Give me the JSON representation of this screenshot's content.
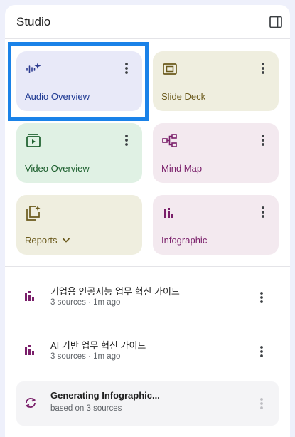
{
  "header": {
    "title": "Studio",
    "toggle_icon": "side-panel-icon"
  },
  "cards": [
    {
      "label": "Audio Overview",
      "icon": "audio-waveform-sparkle-icon",
      "color": "#1f3a93",
      "bg": "#e8e9f8"
    },
    {
      "label": "Slide Deck",
      "icon": "slides-icon",
      "color": "#6b5a1c",
      "bg": "#efeedf"
    },
    {
      "label": "Video Overview",
      "icon": "video-icon",
      "color": "#1b5e2c",
      "bg": "#e0f1e4"
    },
    {
      "label": "Mind Map",
      "icon": "mind-map-icon",
      "color": "#7a1f6a",
      "bg": "#f3e9ef"
    },
    {
      "label": "Reports",
      "icon": "reports-icon",
      "color": "#6b5a1c",
      "bg": "#efeedf"
    },
    {
      "label": "Infographic",
      "icon": "infographic-icon",
      "color": "#7a1f6a",
      "bg": "#f3e9ef"
    }
  ],
  "selection_color": "#1a82e8",
  "notes": [
    {
      "title": "기업용 인공지능 업무 혁신 가이드",
      "subtitle": "3 sources · 1m ago",
      "icon": "infographic-icon"
    },
    {
      "title": "AI 기반 업무 혁신 가이드",
      "subtitle": "3 sources · 1m ago",
      "icon": "infographic-icon"
    },
    {
      "title": "Generating Infographic...",
      "subtitle": "based on 3 sources",
      "icon": "sync-icon"
    }
  ]
}
